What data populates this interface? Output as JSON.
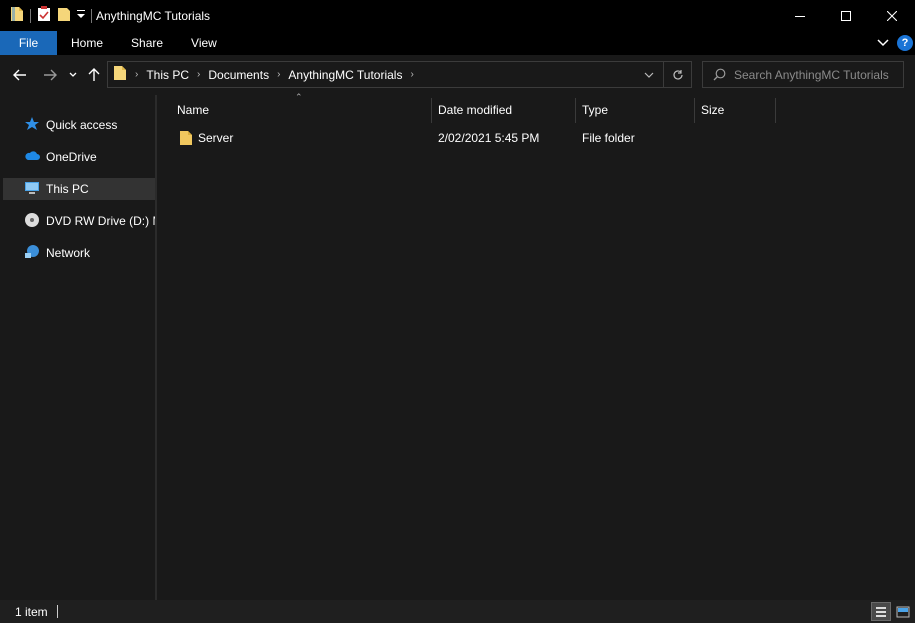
{
  "window": {
    "title": "AnythingMC Tutorials"
  },
  "ribbon": {
    "tabs": [
      {
        "label": "File"
      },
      {
        "label": "Home"
      },
      {
        "label": "Share"
      },
      {
        "label": "View"
      }
    ],
    "help_label": "?"
  },
  "address": {
    "breadcrumbs": [
      "This PC",
      "Documents",
      "AnythingMC Tutorials"
    ]
  },
  "search": {
    "placeholder": "Search AnythingMC Tutorials"
  },
  "sidebar": {
    "items": [
      {
        "label": "Quick access",
        "icon": "star-icon"
      },
      {
        "label": "OneDrive",
        "icon": "cloud-icon"
      },
      {
        "label": "This PC",
        "icon": "computer-icon",
        "selected": true
      },
      {
        "label": "DVD RW Drive (D:) M",
        "icon": "disc-icon"
      },
      {
        "label": "Network",
        "icon": "network-icon"
      }
    ]
  },
  "table": {
    "columns": [
      "Name",
      "Date modified",
      "Type",
      "Size"
    ],
    "rows": [
      {
        "name": "Server",
        "date": "2/02/2021 5:45 PM",
        "type": "File folder",
        "size": ""
      }
    ]
  },
  "status": {
    "count": "1 item"
  },
  "colors": {
    "accent": "#1a68b8",
    "background": "#191919",
    "folder": "#f0c75e"
  }
}
